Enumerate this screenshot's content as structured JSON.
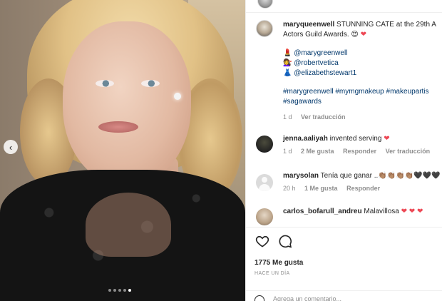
{
  "post": {
    "carousel": {
      "dots": 5,
      "active_index": 4
    },
    "prev_label": "‹"
  },
  "caption": {
    "username": "maryqueenwell",
    "text_line1": "STUNNING CATE at the 29th A",
    "text_line2": "Actors Guild Awards.",
    "line2_emoji": "😍",
    "mentions": [
      {
        "emoji": "💄",
        "handle": "@marygreenwell"
      },
      {
        "emoji": "💇‍♀️",
        "handle": "@robertvetica"
      },
      {
        "emoji": "👗",
        "handle": "@elizabethstewart1"
      }
    ],
    "hashtags_line1": "#marygreenwell #mymgmakeup #makeupartis",
    "hashtags_line2": "#sagawards",
    "time": "1 d",
    "translate": "Ver traducción"
  },
  "comments": [
    {
      "username": "jenna.aaliyah",
      "text": "invented serving",
      "time": "1 d",
      "likes": "2 Me gusta",
      "reply": "Responder",
      "translate": "Ver traducción"
    },
    {
      "username": "marysolan",
      "text": "Tenía que ganar ..",
      "emojis": "👏🏽👏🏽👏🏽👏🏽🖤🖤🖤",
      "time": "20 h",
      "likes": "1 Me gusta",
      "reply": "Responder"
    },
    {
      "username": "carlos_bofarull_andreu",
      "text": "Malavillosa"
    }
  ],
  "actions": {
    "likes_count": "1775 Me gusta",
    "posted_ago": "HACE UN DÍA",
    "add_comment_placeholder": "Agrega un comentario..."
  },
  "icons": [
    "heart-icon",
    "comment-icon",
    "share-icon",
    "more-icon",
    "smile-icon"
  ],
  "colors": {
    "link": "#00376b",
    "heart": "#ed4956",
    "muted": "#8e8e8e",
    "text": "#262626"
  }
}
